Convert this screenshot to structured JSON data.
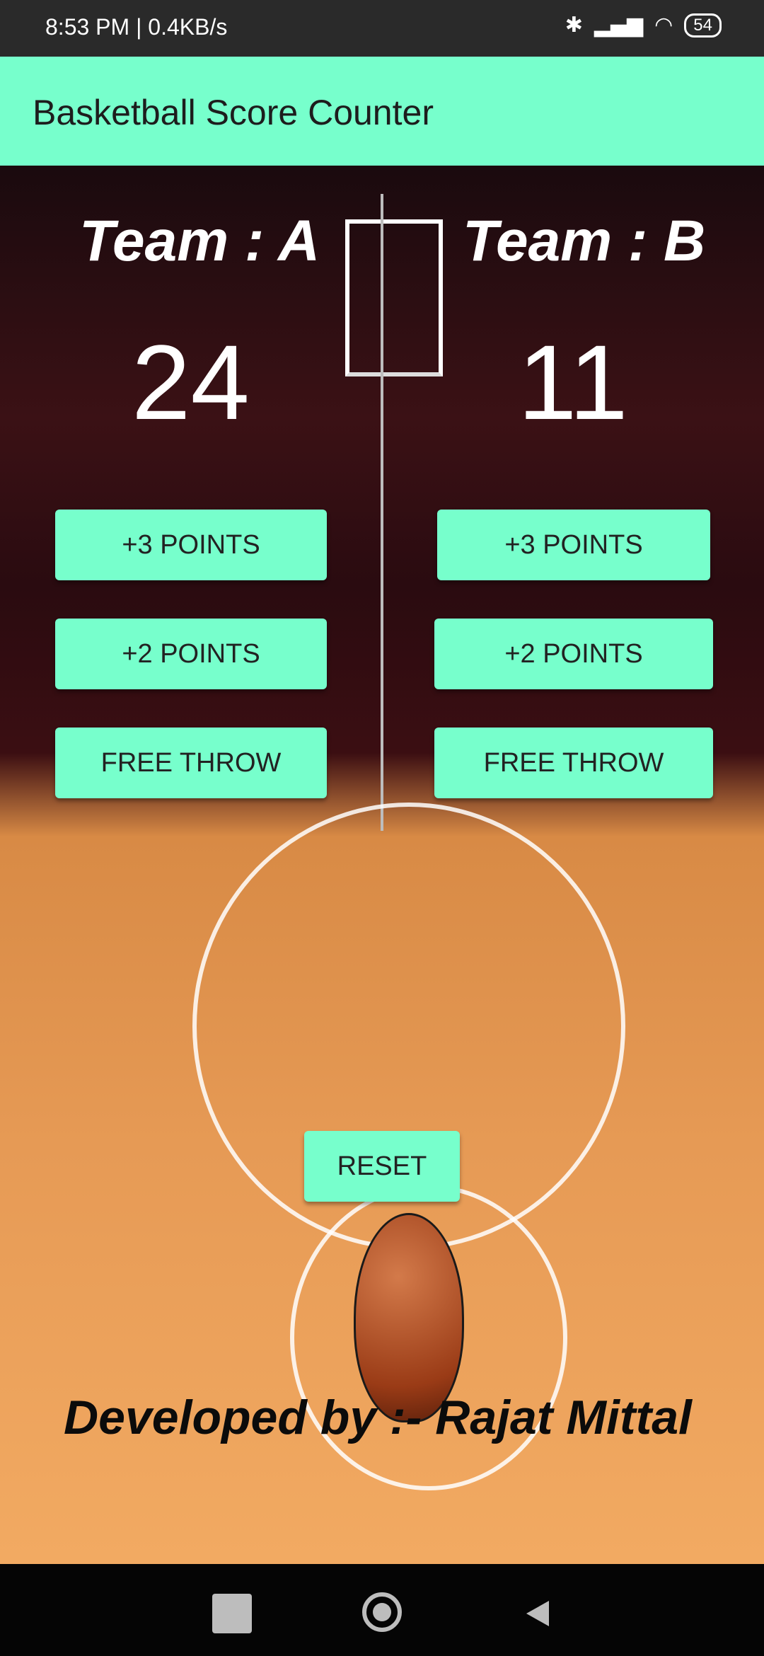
{
  "status_bar": {
    "time_and_speed": "8:53 PM | 0.4KB/s",
    "battery": "54"
  },
  "app_bar": {
    "title": "Basketball Score Counter"
  },
  "team_a": {
    "name": "Team : A",
    "score": "24",
    "buttons": [
      "+3 POINTS",
      "+2 POINTS",
      "FREE THROW"
    ]
  },
  "team_b": {
    "name": "Team : B",
    "score": "11",
    "buttons": [
      "+3 POINTS",
      "+2 POINTS",
      "FREE THROW"
    ]
  },
  "reset_label": "RESET",
  "footer_text": "Developed by :- Rajat Mittal",
  "colors": {
    "accent": "#77ffcc",
    "appbar": "#77ffcc"
  }
}
